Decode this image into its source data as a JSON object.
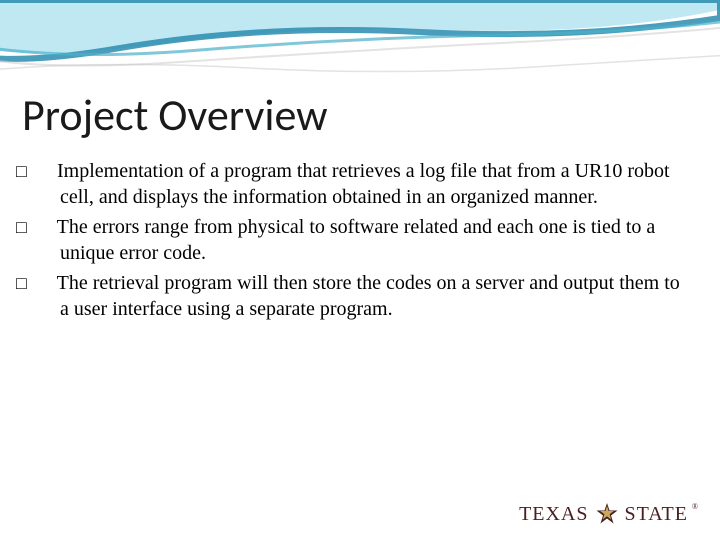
{
  "title": "Project Overview",
  "bullets": [
    "Implementation of a program that retrieves a log file that from a UR10 robot cell, and displays the information obtained in an organized manner.",
    "The errors range from physical to software related and each one is tied to a unique error code.",
    "The retrieval program will then store the codes on a server and output them to a user interface using a separate program."
  ],
  "logo": {
    "part1": "TEXAS",
    "part2": "STATE",
    "trademark": "®"
  },
  "colors": {
    "wave_light": "#9dd7e8",
    "wave_dark": "#1a7a9e",
    "logo_maroon": "#4a1e1e",
    "logo_gold": "#c9a961"
  }
}
